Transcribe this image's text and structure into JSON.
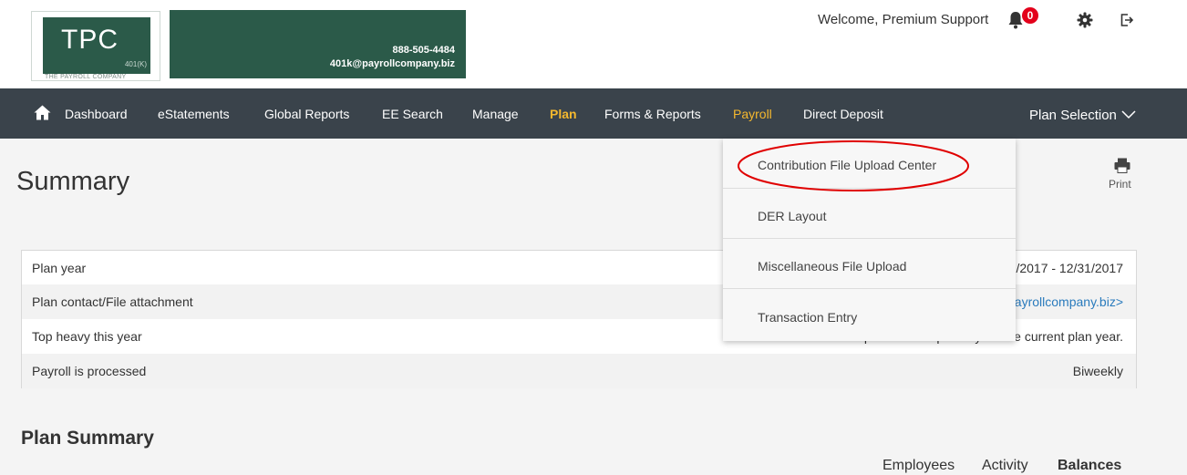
{
  "header": {
    "logo": {
      "brand": "TPC",
      "tag": "401(K)",
      "sub": "THE PAYROLL COMPANY"
    },
    "banner": {
      "phone": "888-505-4484",
      "email": "401k@payrollcompany.biz"
    },
    "welcome": "Welcome,  Premium Support",
    "notifications_count": "0"
  },
  "nav": {
    "items": [
      {
        "label": "Dashboard"
      },
      {
        "label": "eStatements"
      },
      {
        "label": "Global Reports"
      },
      {
        "label": "EE Search"
      },
      {
        "label": "Manage"
      },
      {
        "label": "Plan"
      },
      {
        "label": "Forms & Reports"
      },
      {
        "label": "Payroll"
      },
      {
        "label": "Direct Deposit"
      }
    ],
    "plan_selection": "Plan Selection"
  },
  "dropdown": {
    "items": [
      {
        "label": "Contribution File Upload Center"
      },
      {
        "label": "DER Layout"
      },
      {
        "label": "Miscellaneous File Upload"
      },
      {
        "label": "Transaction Entry"
      }
    ]
  },
  "main": {
    "title": "Summary",
    "print_label": "Print",
    "rows": [
      {
        "label": "Plan year",
        "value": "01/01/2017 - 12/31/2017"
      },
      {
        "label": "Plan contact/File attachment",
        "value": "Lynn Sheehan <lynns@payrollcompany.biz>"
      },
      {
        "label": "Top heavy this year",
        "value": "This plan is not top heavy for the current plan year."
      },
      {
        "label": "Payroll is processed",
        "value": "Biweekly"
      }
    ],
    "plan_summary_title": "Plan Summary",
    "tabs": [
      {
        "label": "Employees"
      },
      {
        "label": "Activity"
      },
      {
        "label": "Balances"
      }
    ]
  },
  "colors": {
    "nav_bg": "#3a434b",
    "accent": "#f5b82e",
    "brand_green": "#2b5a49",
    "badge_red": "#e3001b",
    "annotation_red": "#e00000"
  }
}
